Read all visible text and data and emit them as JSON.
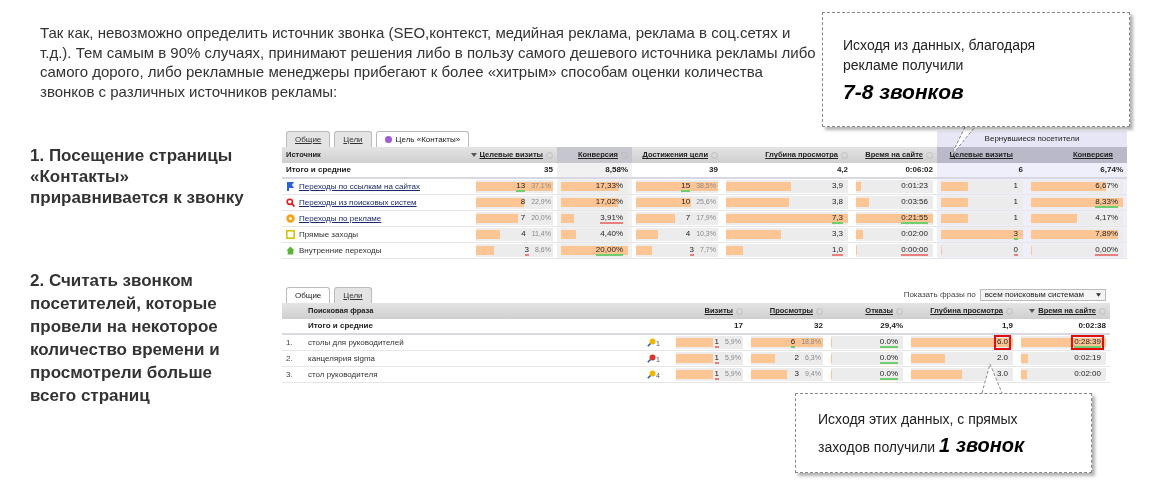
{
  "intro": "Так как, невозможно определить источник звонка (SEO,контекст, медийная реклама,  реклама в соц.сетях и т.д.). Тем самым в 90% случаях, принимают решения либо в пользу самого дешевого источника рекламы либо самого дорого, либо рекламные менеджеры прибегают к более «хитрым»  способам оценки количества звонков с различных источников рекламы:",
  "callouts": [
    {
      "text": "Исходя из данных, благодаря рекламе  получили",
      "emphasis": "7-8 звонков",
      "kind": "top"
    },
    {
      "text": "Исходя этих данных,  с прямых заходов получили",
      "emphasis": "1 звонок",
      "kind": "bottom"
    }
  ],
  "methods": [
    {
      "label": "1. Посещение страницы «Контакты» приравнивается к звонку"
    },
    {
      "label": "2. Считать звонком посетителей, которые провели на некоторое количество времени и просмотрели больше всего страниц"
    }
  ],
  "sources_table": {
    "tabs": [
      {
        "label": "Общие",
        "selected": false
      },
      {
        "label": "Цели",
        "selected": false
      },
      {
        "label": "Цель «Контакты»",
        "selected": true
      }
    ],
    "group_label": "Вернувшиеся посетители",
    "label_column": "Источник",
    "columns": [
      {
        "label": "Целевые визиты",
        "sorted": true,
        "shaded": false,
        "group": false
      },
      {
        "label": "Конверсия",
        "sorted": false,
        "shaded": true,
        "group": false
      },
      {
        "label": "Достижения цели",
        "sorted": false,
        "shaded": false,
        "group": false
      },
      {
        "label": "Глубина просмотра",
        "sorted": false,
        "shaded": false,
        "group": false
      },
      {
        "label": "Время на сайте",
        "sorted": false,
        "shaded": false,
        "group": false
      },
      {
        "label": "Целевые визиты",
        "sorted": false,
        "shaded": false,
        "group": true
      },
      {
        "label": "Конверсия",
        "sorted": false,
        "shaded": false,
        "group": true
      }
    ],
    "total": {
      "label": "Итого и средние",
      "cells": [
        {
          "value": "35"
        },
        {
          "value": "8,58%"
        },
        {
          "value": "39"
        },
        {
          "value": "4,2"
        },
        {
          "value": "0:06:02"
        },
        {
          "value": "6"
        },
        {
          "value": "6,74%"
        }
      ]
    },
    "rows": [
      {
        "label": "Переходы по ссылкам на сайтах",
        "kind": "flag",
        "link": true,
        "cells": [
          {
            "value": "13",
            "share": "37,1%",
            "level": 1,
            "color": "#6fcf6f"
          },
          {
            "value": "17,33%",
            "level": 0.87
          },
          {
            "value": "15",
            "share": "38,5%",
            "level": 1,
            "color": "#6fcf6f"
          },
          {
            "value": "3,9",
            "level": 0.53
          },
          {
            "value": "0:01:23",
            "level": 0.06
          },
          {
            "value": "1",
            "level": 0.33
          },
          {
            "value": "6,67%",
            "level": 0.82
          }
        ]
      },
      {
        "label": "Переходы из поисковых систем",
        "kind": "search",
        "link": true,
        "cells": [
          {
            "value": "8",
            "share": "22,9%",
            "level": 0.62
          },
          {
            "value": "17,02%",
            "level": 0.85
          },
          {
            "value": "10",
            "share": "25,6%",
            "level": 0.67
          },
          {
            "value": "3,8",
            "level": 0.52
          },
          {
            "value": "0:03:56",
            "level": 0.17
          },
          {
            "value": "1",
            "level": 0.33
          },
          {
            "value": "8,33%",
            "level": 1,
            "color": "#6fcf6f"
          }
        ]
      },
      {
        "label": "Переходы по рекламе",
        "kind": "ads",
        "link": true,
        "cells": [
          {
            "value": "7",
            "share": "20,0%",
            "level": 0.55
          },
          {
            "value": "3,91%",
            "level": 0.2,
            "color": "#e88080"
          },
          {
            "value": "7",
            "share": "17,9%",
            "level": 0.47
          },
          {
            "value": "7,3",
            "level": 1,
            "color": "#6fcf6f"
          },
          {
            "value": "0:21:55",
            "level": 1,
            "color": "#6fcf6f"
          },
          {
            "value": "1",
            "level": 0.33
          },
          {
            "value": "4,17%",
            "level": 0.5
          }
        ]
      },
      {
        "label": "Прямые заходы",
        "kind": "direct",
        "link": false,
        "cells": [
          {
            "value": "4",
            "share": "11,4%",
            "level": 0.31
          },
          {
            "value": "4,40%",
            "level": 0.22
          },
          {
            "value": "4",
            "share": "10,3%",
            "level": 0.27
          },
          {
            "value": "3,3",
            "level": 0.45
          },
          {
            "value": "0:02:00",
            "level": 0.09
          },
          {
            "value": "3",
            "level": 1,
            "color": "#6fcf6f"
          },
          {
            "value": "7,89%",
            "level": 0.95
          }
        ]
      },
      {
        "label": "Внутренние переходы",
        "kind": "home",
        "link": false,
        "cells": [
          {
            "value": "3",
            "share": "8,6%",
            "level": 0.23,
            "color": "#e88080"
          },
          {
            "value": "20,00%",
            "level": 1,
            "color": "#6fcf6f"
          },
          {
            "value": "3",
            "share": "7,7%",
            "level": 0.2,
            "color": "#e88080"
          },
          {
            "value": "1,0",
            "level": 0.14,
            "color": "#e88080"
          },
          {
            "value": "0:00:00",
            "level": 0.01,
            "color": "#e88080"
          },
          {
            "value": "0",
            "level": 0.01,
            "color": "#e88080"
          },
          {
            "value": "0,00%",
            "level": 0.01,
            "color": "#e88080"
          }
        ]
      }
    ]
  },
  "phrases_table": {
    "tabs": [
      {
        "label": "Общие",
        "selected": true
      },
      {
        "label": "Цели",
        "selected": false
      }
    ],
    "filter": {
      "label": "Показать фразы по",
      "value": "всем поисковым системам"
    },
    "label_column": "Поисковая фраза",
    "columns": [
      {
        "label": "Визиты",
        "sorted": false
      },
      {
        "label": "Просмотры",
        "sorted": false
      },
      {
        "label": "Отказы",
        "sorted": false
      },
      {
        "label": "Глубина просмотра",
        "sorted": false
      },
      {
        "label": "Время на сайте",
        "sorted": true
      }
    ],
    "total": {
      "label": "Итого и средние",
      "cells": [
        {
          "value": "17"
        },
        {
          "value": "32"
        },
        {
          "value": "29,4%"
        },
        {
          "value": "1,9"
        },
        {
          "value": "0:02:38"
        }
      ]
    },
    "rows": [
      {
        "number": "1.",
        "phrase": "столы для руководителей",
        "color": "#f2b600",
        "engine_count": "1",
        "cells": [
          {
            "value": "1",
            "share": "5,9%",
            "level": 0.55,
            "color": "#e88080",
            "boxed": false
          },
          {
            "value": "6",
            "share": "18,8%",
            "level": 1,
            "color": "#6fcf6f",
            "boxed": false
          },
          {
            "value": "0.0%",
            "level": 0.02,
            "color": "#6fcf6f",
            "boxed": false
          },
          {
            "value": "6.0",
            "level": 1,
            "boxed": true
          },
          {
            "value": "0:28:39",
            "level": 1,
            "color": "#6fcf6f",
            "boxed": true
          }
        ]
      },
      {
        "number": "2.",
        "phrase": "канцелярия sigma",
        "color": "#d9372b",
        "engine_count": "1",
        "cells": [
          {
            "value": "1",
            "share": "5,9%",
            "level": 0.55,
            "color": "#e88080",
            "boxed": false
          },
          {
            "value": "2",
            "share": "6,3%",
            "level": 0.33,
            "boxed": false
          },
          {
            "value": "0.0%",
            "level": 0.02,
            "color": "#6fcf6f",
            "boxed": false
          },
          {
            "value": "2.0",
            "level": 0.33,
            "boxed": false
          },
          {
            "value": "0:02:19",
            "level": 0.08,
            "boxed": false
          }
        ]
      },
      {
        "number": "3.",
        "phrase": "стол руководителя",
        "color": "#f2b600",
        "engine_count": "4",
        "cells": [
          {
            "value": "1",
            "share": "5,9%",
            "level": 0.55,
            "color": "#e88080",
            "boxed": false
          },
          {
            "value": "3",
            "share": "9,4%",
            "level": 0.5,
            "boxed": false
          },
          {
            "value": "0.0%",
            "level": 0.02,
            "color": "#6fcf6f",
            "boxed": false
          },
          {
            "value": "3.0",
            "level": 0.5,
            "boxed": false
          },
          {
            "value": "0:02:00",
            "level": 0.07,
            "boxed": false
          }
        ]
      }
    ]
  }
}
